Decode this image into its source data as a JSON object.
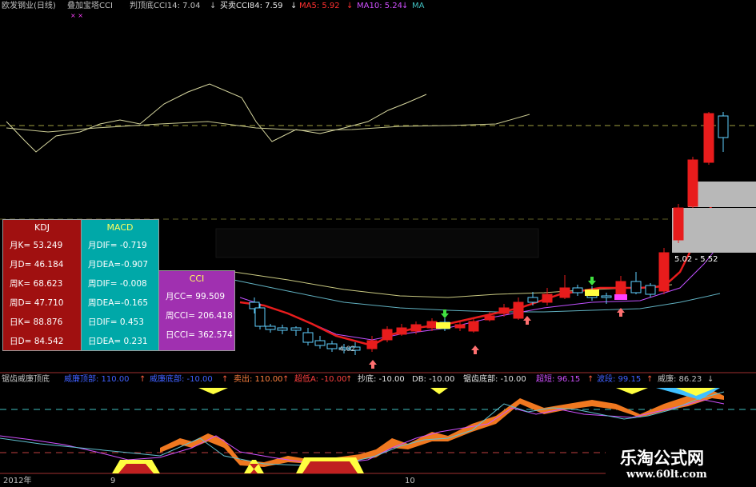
{
  "header": {
    "main_title": "欧发钢业(日线)",
    "indicator": "叠加宝塔CCI",
    "cci14": "判顶底CCI14: 7.04",
    "cci84": "买卖CCI84: 7.59",
    "ma5": "MA5: 5.92",
    "ma10": "MA10: 5.24",
    "ma_more": "MA",
    "arrow_down": "↓",
    "marks": "× ×"
  },
  "colors": {
    "red": "#e81c1c",
    "cyan": "#00c8c8",
    "yellow": "#d8d860",
    "magenta": "#c050ff",
    "orange": "#f07820",
    "panel_kdj": "#a01010",
    "panel_macd": "#00a8a8",
    "panel_cci": "#a030b0"
  },
  "panels": {
    "kdj": {
      "title": "KDJ",
      "rows": [
        "月K=  53.249",
        "月D=  46.184",
        "周K=  68.623",
        "周D=  47.710",
        "日K=  88.876",
        "日D=  84.542"
      ]
    },
    "macd": {
      "title": "MACD",
      "rows": [
        "月DIF= -0.719",
        "月DEA=-0.907",
        "周DIF= -0.008",
        "周DEA=-0.165",
        "日DIF=  0.453",
        "日DEA=  0.231"
      ]
    },
    "cci": {
      "title": "CCI",
      "rows": [
        "月CC=  99.509",
        "周CCI= 206.418",
        "日CCI= 362.574"
      ]
    }
  },
  "price_labels": {
    "range": "5.02 - 5.52",
    "low": "4.02"
  },
  "lower_header": {
    "name": "锯齿威廉顶底",
    "items": [
      {
        "text": "威廉顶部: 110.00",
        "arrow": "↑"
      },
      {
        "text": "威廉底部: -10.00",
        "arrow": "↑"
      },
      {
        "text": "卖出: 110.00",
        "arrow": "↑"
      },
      {
        "text": "超低A: -10.00",
        "arrow": "↑"
      },
      {
        "text": "抄底: -10.00",
        "arrow": ""
      },
      {
        "text": "DB: -10.00",
        "arrow": ""
      },
      {
        "text": "锯齿底部: -10.00",
        "arrow": ""
      },
      {
        "text": "超短: 96.15",
        "arrow": "↑"
      },
      {
        "text": "波段: 99.15",
        "arrow": "↑"
      },
      {
        "text": "威廉: 86.23",
        "arrow": "↓"
      }
    ]
  },
  "time_axis": {
    "year": "2012年",
    "m9": "9",
    "m10": "10"
  },
  "watermark": {
    "cn": "乐淘公式网",
    "url": "www.60lt.com"
  }
}
